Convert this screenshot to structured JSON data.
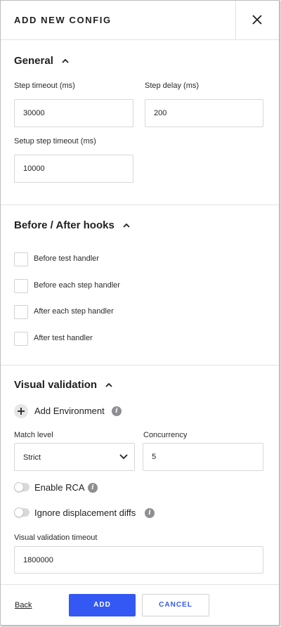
{
  "header": {
    "title": "ADD NEW CONFIG",
    "close_icon": "close-icon"
  },
  "general": {
    "title": "General",
    "step_timeout": {
      "label": "Step timeout (ms)",
      "value": "30000"
    },
    "step_delay": {
      "label": "Step delay (ms)",
      "value": "200"
    },
    "setup_step_timeout": {
      "label": "Setup step timeout (ms)",
      "value": "10000"
    }
  },
  "hooks": {
    "title": "Before / After hooks",
    "items": [
      {
        "label": "Before test handler"
      },
      {
        "label": "Before each step handler"
      },
      {
        "label": "After each step handler"
      },
      {
        "label": "After test handler"
      }
    ]
  },
  "visual": {
    "title": "Visual validation",
    "add_environment": "Add Environment",
    "match_level": {
      "label": "Match level",
      "value": "Strict"
    },
    "concurrency": {
      "label": "Concurrency",
      "value": "5"
    },
    "enable_rca": "Enable RCA",
    "ignore_displacement": "Ignore displacement diffs",
    "timeout": {
      "label": "Visual validation timeout",
      "value": "1800000"
    }
  },
  "footer": {
    "back": "Back",
    "add": "ADD",
    "cancel": "CANCEL"
  },
  "colors": {
    "primary": "#3358f4",
    "info": "#8e8e93",
    "border": "#d7d7d7"
  }
}
